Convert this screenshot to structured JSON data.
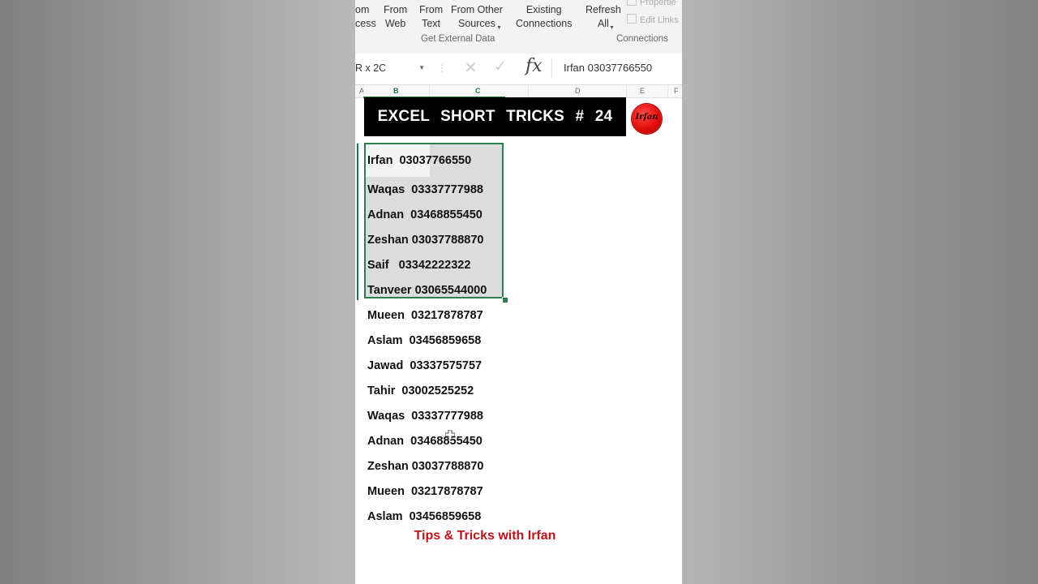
{
  "ribbon": {
    "items": [
      {
        "label": "om\ncess"
      },
      {
        "label": "From\nWeb"
      },
      {
        "label": "From\nText"
      },
      {
        "label": "From Other\nSources"
      },
      {
        "label": "Existing\nConnections"
      },
      {
        "label": "Refresh\nAll"
      }
    ],
    "small_items": [
      "Propertie",
      "Edit Links"
    ],
    "groups": [
      "Get External Data",
      "Connections"
    ]
  },
  "formula_bar": {
    "name_box": "R x 2C",
    "content": "Irfan  03037766550"
  },
  "columns": [
    "A",
    "B",
    "C",
    "D",
    "E",
    "F"
  ],
  "active_column": "B",
  "banner": {
    "title": "EXCEL SHORT TRICKS # 24"
  },
  "rows": [
    "Irfan  03037766550",
    "Waqas  03337777988",
    "Adnan  03468855450",
    "Zeshan 03037788870",
    "Saif   03342222322",
    "Tanveer 03065544000",
    "Mueen  03217878787",
    "Aslam  03456859658",
    "Jawad  03337575757",
    "Tahir  03002525252",
    "Waqas  03337777988",
    "Adnan  03468855450",
    "Zeshan 03037788870",
    "Mueen  03217878787",
    "Aslam  03456859658"
  ],
  "footer": {
    "text": "Tips & Tricks with Irfan"
  },
  "colors": {
    "selection_border": "#2e7d4f",
    "banner_bg": "#000000",
    "footer_text": "#c0121b",
    "logo": "#e30d0d"
  }
}
